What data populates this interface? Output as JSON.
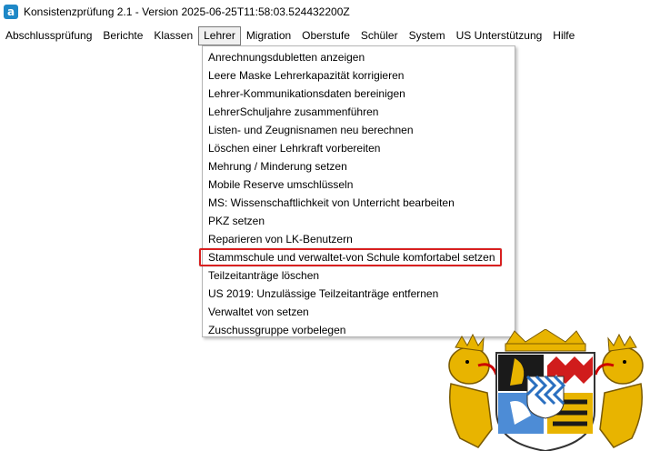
{
  "window": {
    "title": "Konsistenzprüfung 2.1 - Version 2025-06-25T11:58:03.524432200Z",
    "icon_letter": "a"
  },
  "menubar": [
    {
      "label": "Abschlussprüfung"
    },
    {
      "label": "Berichte"
    },
    {
      "label": "Klassen"
    },
    {
      "label": "Lehrer",
      "active": true
    },
    {
      "label": "Migration"
    },
    {
      "label": "Oberstufe"
    },
    {
      "label": "Schüler"
    },
    {
      "label": "System"
    },
    {
      "label": "US Unterstützung"
    },
    {
      "label": "Hilfe"
    }
  ],
  "lehrer_menu": {
    "items": [
      "Anrechnungsdubletten anzeigen",
      "Leere Maske Lehrerkapazität korrigieren",
      "Lehrer-Kommunikationsdaten bereinigen",
      "LehrerSchuljahre zusammenführen",
      "Listen- und Zeugnisnamen neu berechnen",
      "Löschen einer Lehrkraft vorbereiten",
      "Mehrung / Minderung setzen",
      "Mobile Reserve umschlüsseln",
      "MS: Wissenschaftlichkeit von Unterricht bearbeiten",
      "PKZ setzen",
      "Reparieren von LK-Benutzern",
      "Stammschule und verwaltet-von Schule komfortabel setzen",
      "Teilzeitanträge löschen",
      "US 2019: Unzulässige Teilzeitanträge entfernen",
      "Verwaltet von setzen",
      "Zuschussgruppe vorbelegen"
    ],
    "highlighted_index": 11
  },
  "colors": {
    "highlight_border": "#d92020",
    "icon_blue": "#1e88c7",
    "lion_gold": "#e8b400",
    "shield_blue": "#2a6fc0"
  }
}
